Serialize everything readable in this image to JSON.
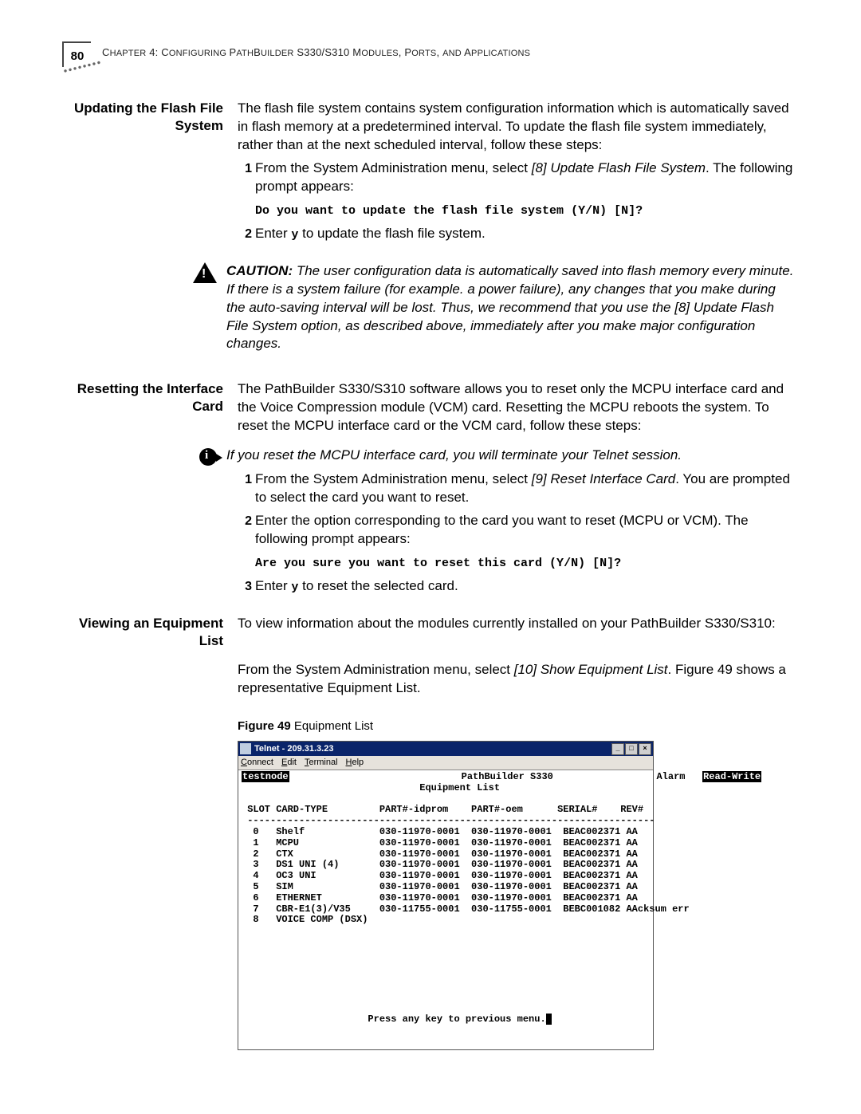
{
  "page": {
    "number": "80",
    "header_prefix": "C",
    "header_rest_1": "HAPTER",
    "header_ch_no": " 4: C",
    "header_rest_2": "ONFIGURING ",
    "header_rest_3": "P",
    "header_rest_4": "ATH",
    "header_rest_5": "B",
    "header_rest_6": "UILDER",
    "header_rest_7": " S330/S310 M",
    "header_rest_8": "ODULES",
    "header_rest_9": ", P",
    "header_rest_10": "ORTS",
    "header_rest_11": ", ",
    "header_rest_12": "AND ",
    "header_rest_13": "A",
    "header_rest_14": "PPLICATIONS"
  },
  "s1": {
    "heading": "Updating the Flash File System",
    "p1": "The flash file system contains system configuration information which is automatically saved in flash memory at a predetermined interval. To update the flash file system immediately, rather than at the next scheduled interval, follow these steps:",
    "step1_no": "1",
    "step1_a": "From the System Administration menu, select ",
    "step1_b": "[8] Update Flash File System",
    "step1_c": ". The following prompt appears:",
    "code1": "Do you want to update the flash file system (Y/N) [N]?",
    "step2_no": "2",
    "step2_a": "Enter ",
    "step2_b": "y",
    "step2_c": " to update the flash file system.",
    "caution_label": "CAUTION:",
    "caution": " The user configuration data is automatically saved into flash memory every minute. If there is a system failure (for example. a power failure), any changes that you make during the auto-saving interval will be lost. Thus, we recommend that you use the [8] Update Flash File System option, as described above, immediately after you make major configuration changes."
  },
  "s2": {
    "heading": "Resetting the Interface Card",
    "p1": "The PathBuilder S330/S310 software allows you to reset only the MCPU interface card and the Voice Compression module (VCM) card. Resetting the MCPU reboots the system. To reset the MCPU interface card or the VCM card, follow these steps:",
    "info": "If you reset the MCPU interface card, you will terminate your Telnet session.",
    "step1_no": "1",
    "step1_a": "From the System Administration menu, select ",
    "step1_b": "[9] Reset Interface Card",
    "step1_c": ". You are prompted to select the card you want to reset.",
    "step2_no": "2",
    "step2": "Enter the option corresponding to the card you want to reset (MCPU or VCM). The following prompt appears:",
    "code2": "Are you sure you want to reset this card (Y/N) [N]?",
    "step3_no": "3",
    "step3_a": "Enter ",
    "step3_b": "y",
    "step3_c": " to reset the selected card."
  },
  "s3": {
    "heading": "Viewing an Equipment List",
    "p1": "To view information about the modules currently installed on your PathBuilder S330/S310:",
    "p2_a": "From the System Administration menu, select ",
    "p2_b": "[10] Show Equipment List",
    "p2_c": ". Figure 49 shows a representative Equipment List.",
    "fig_label": "Figure 49",
    "fig_caption": "   Equipment List"
  },
  "telnet": {
    "title": "Telnet - 209.31.3.23",
    "menu": {
      "m1": "Connect",
      "m2": "Edit",
      "m3": "Terminal",
      "m4": "Help"
    },
    "btn_min": "_",
    "btn_max": "□",
    "btn_close": "×",
    "line_host": "testnode",
    "line_title1": "                              PathBuilder S330                  Alarm   ",
    "line_title1_rw": "Read-Write",
    "line_title2": "                               Equipment List",
    "line_hdr": " SLOT CARD-TYPE         PART#-idprom    PART#-oem      SERIAL#    REV#",
    "line_sep": " -----------------------------------------------------------------------",
    "rows": [
      "  0   Shelf             030-11970-0001  030-11970-0001  BEAC002371 AA",
      "  1   MCPU              030-11970-0001  030-11970-0001  BEAC002371 AA",
      "  2   CTX               030-11970-0001  030-11970-0001  BEAC002371 AA",
      "  3   DS1 UNI (4)       030-11970-0001  030-11970-0001  BEAC002371 AA",
      "  4   OC3 UNI           030-11970-0001  030-11970-0001  BEAC002371 AA",
      "  5   SIM               030-11970-0001  030-11970-0001  BEAC002371 AA",
      "  6   ETHERNET          030-11970-0001  030-11970-0001  BEAC002371 AA",
      "  7   CBR-E1(3)/V35     030-11755-0001  030-11755-0001  BEBC001082 AAcksum err",
      "  8   VOICE COMP (DSX)"
    ],
    "footer": "                      Press any key to previous menu."
  }
}
